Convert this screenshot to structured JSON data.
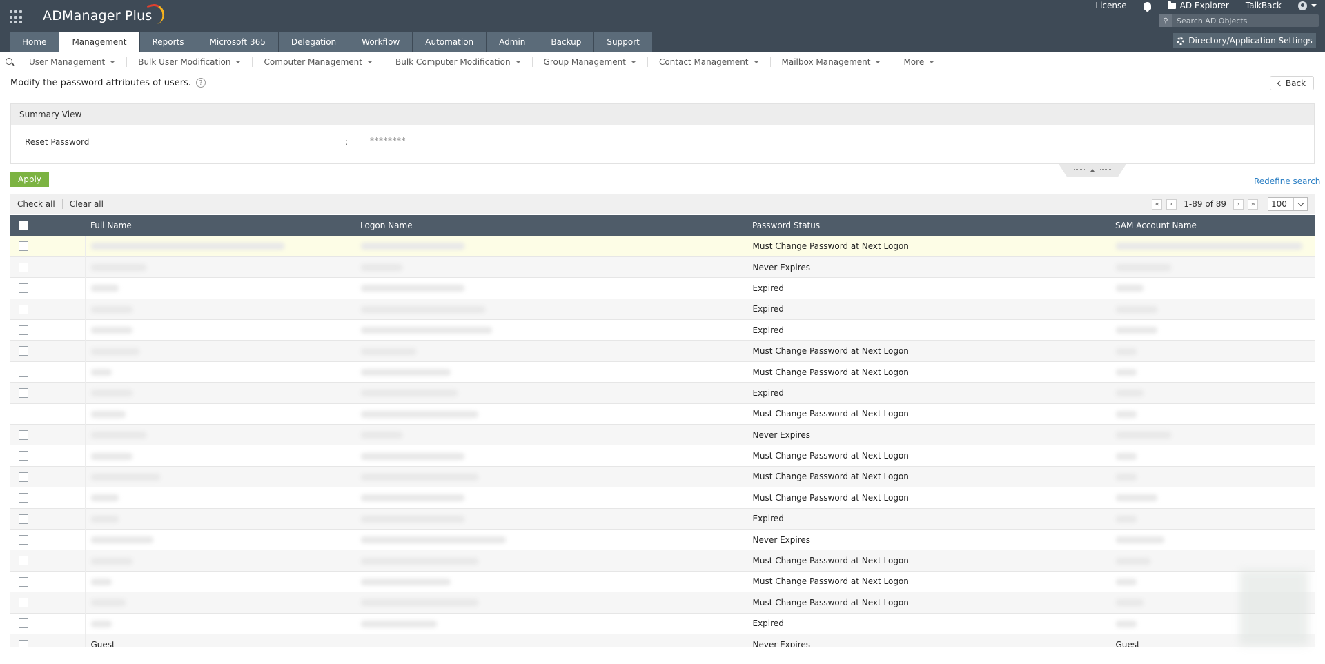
{
  "header": {
    "app_name": "ADManager Plus",
    "links": {
      "license": "License",
      "ad_explorer": "AD Explorer",
      "talkback": "TalkBack"
    },
    "search_placeholder": "Search AD Objects",
    "settings_label": "Directory/Application Settings",
    "tabs": [
      {
        "label": "Home"
      },
      {
        "label": "Management",
        "active": true
      },
      {
        "label": "Reports"
      },
      {
        "label": "Microsoft 365"
      },
      {
        "label": "Delegation"
      },
      {
        "label": "Workflow"
      },
      {
        "label": "Automation"
      },
      {
        "label": "Admin"
      },
      {
        "label": "Backup"
      },
      {
        "label": "Support"
      }
    ]
  },
  "subnav": {
    "items": [
      {
        "label": "User Management"
      },
      {
        "label": "Bulk User Modification"
      },
      {
        "label": "Computer Management"
      },
      {
        "label": "Bulk Computer Modification"
      },
      {
        "label": "Group Management"
      },
      {
        "label": "Contact Management"
      },
      {
        "label": "Mailbox Management"
      },
      {
        "label": "More"
      }
    ]
  },
  "page": {
    "title": "Modify the password attributes of users.",
    "help": "?",
    "back_label": "Back"
  },
  "summary": {
    "heading": "Summary View",
    "field_label": "Reset Password",
    "separator": ":",
    "field_value": "********"
  },
  "actions": {
    "apply_label": "Apply",
    "redefine_label": "Redefine search",
    "check_all": "Check all",
    "clear_all": "Clear all"
  },
  "pagination": {
    "range": "1-89 of 89",
    "page_size": "100"
  },
  "table": {
    "columns": {
      "full_name": "Full Name",
      "logon_name": "Logon Name",
      "password_status": "Password Status",
      "sam_account_name": "SAM Account Name"
    },
    "rows": [
      {
        "status": "Must Change Password at Next Logon"
      },
      {
        "status": "Never Expires"
      },
      {
        "status": "Expired"
      },
      {
        "status": "Expired"
      },
      {
        "status": "Expired"
      },
      {
        "status": "Must Change Password at Next Logon"
      },
      {
        "status": "Must Change Password at Next Logon"
      },
      {
        "status": "Expired"
      },
      {
        "status": "Must Change Password at Next Logon"
      },
      {
        "status": "Never Expires"
      },
      {
        "status": "Must Change Password at Next Logon"
      },
      {
        "status": "Must Change Password at Next Logon"
      },
      {
        "status": "Must Change Password at Next Logon"
      },
      {
        "status": "Expired"
      },
      {
        "status": "Never Expires"
      },
      {
        "status": "Must Change Password at Next Logon"
      },
      {
        "status": "Must Change Password at Next Logon"
      },
      {
        "status": "Must Change Password at Next Logon"
      },
      {
        "status": "Expired"
      }
    ],
    "partial_row": {
      "full_name": "Guest",
      "status": "Never Expires",
      "sam": "Guest"
    }
  }
}
